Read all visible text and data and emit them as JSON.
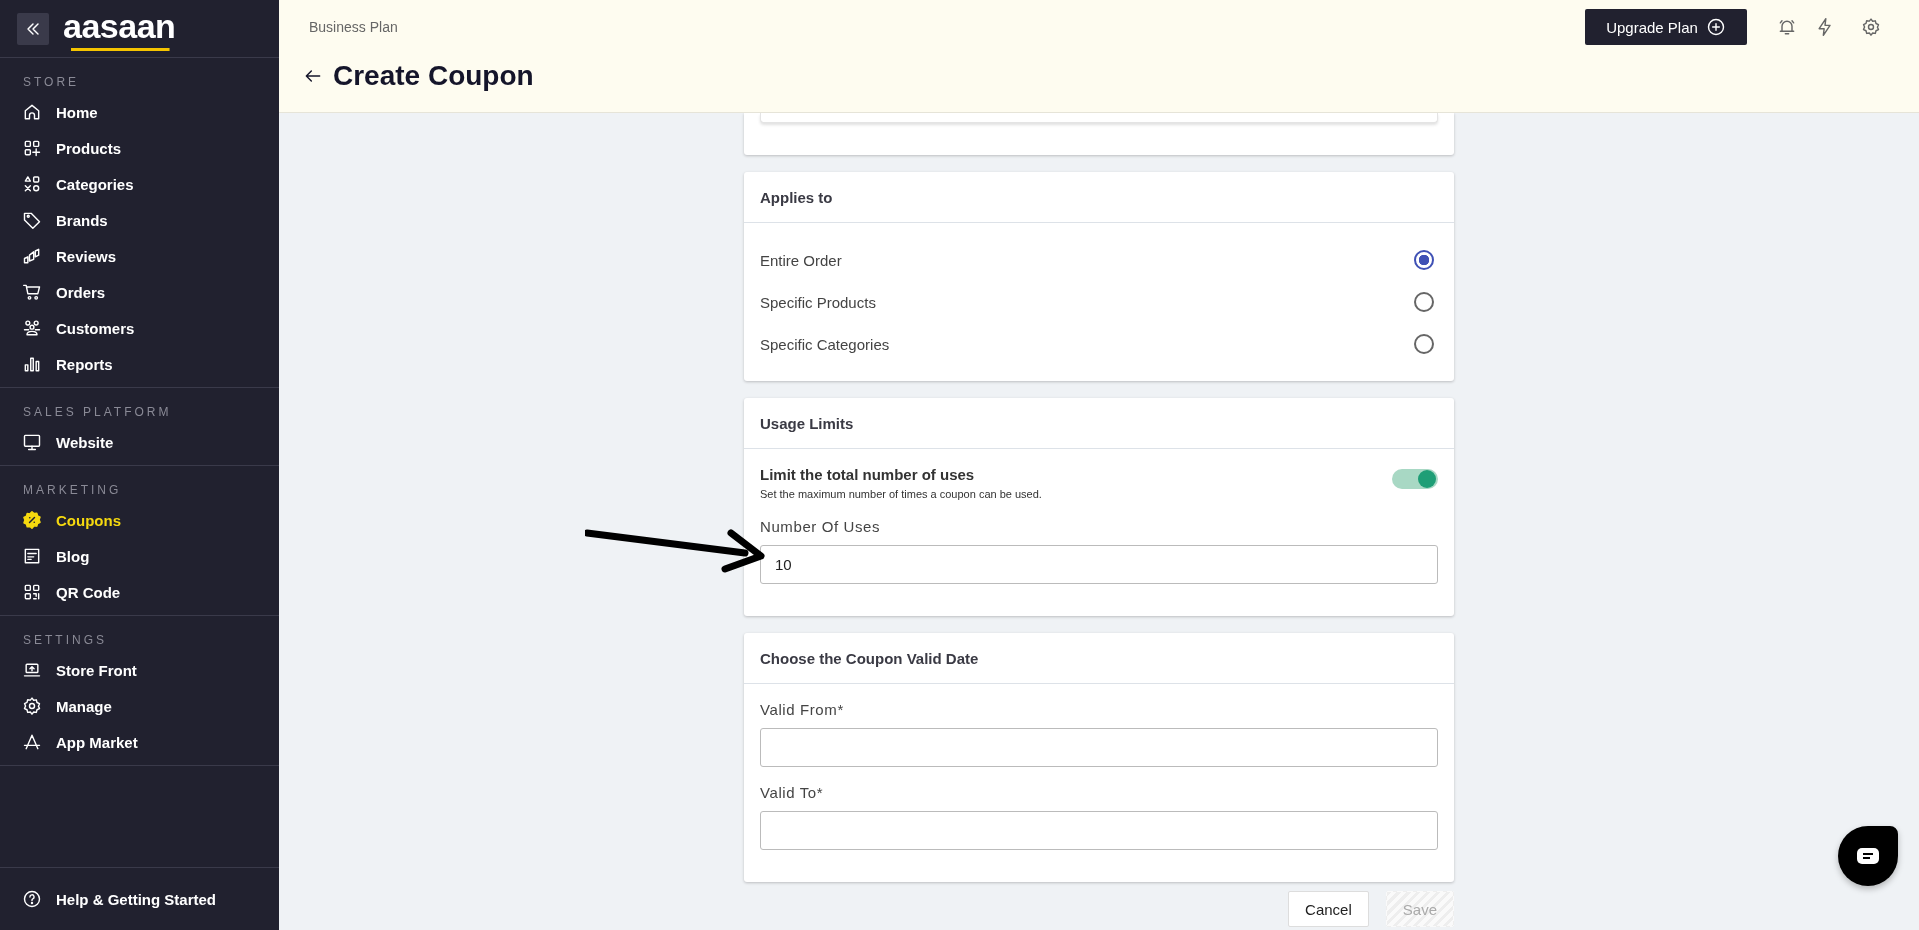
{
  "sidebar": {
    "logo": "aasaan",
    "sections": [
      {
        "title": "STORE",
        "items": [
          {
            "label": "Home",
            "selected": false
          },
          {
            "label": "Products",
            "selected": false
          },
          {
            "label": "Categories",
            "selected": false
          },
          {
            "label": "Brands",
            "selected": false
          },
          {
            "label": "Reviews",
            "selected": false
          },
          {
            "label": "Orders",
            "selected": false
          },
          {
            "label": "Customers",
            "selected": false
          },
          {
            "label": "Reports",
            "selected": false
          }
        ]
      },
      {
        "title": "SALES PLATFORM",
        "items": [
          {
            "label": "Website",
            "selected": false
          }
        ]
      },
      {
        "title": "MARKETING",
        "items": [
          {
            "label": "Coupons",
            "selected": true
          },
          {
            "label": "Blog",
            "selected": false
          },
          {
            "label": "QR Code",
            "selected": false
          }
        ]
      },
      {
        "title": "SETTINGS",
        "items": [
          {
            "label": "Store Front",
            "selected": false
          },
          {
            "label": "Manage",
            "selected": false
          },
          {
            "label": "App Market",
            "selected": false
          }
        ]
      }
    ],
    "help": "Help & Getting Started"
  },
  "header": {
    "plan": "Business Plan",
    "title": "Create Coupon",
    "upgrade_button": "Upgrade Plan"
  },
  "applies_to": {
    "title": "Applies to",
    "options": [
      {
        "label": "Entire Order",
        "selected": true
      },
      {
        "label": "Specific Products",
        "selected": false
      },
      {
        "label": "Specific Categories",
        "selected": false
      }
    ]
  },
  "usage_limits": {
    "title": "Usage Limits",
    "toggle": {
      "label": "Limit the total number of uses",
      "description": "Set the maximum number of times a coupon can be used.",
      "on": true
    },
    "field": {
      "label": "Number Of Uses",
      "value": "10"
    }
  },
  "valid_date": {
    "title": "Choose the Coupon Valid Date",
    "fields": [
      {
        "label": "Valid From*"
      },
      {
        "label": "Valid To*"
      }
    ]
  },
  "actions": [
    {
      "label": "Cancel",
      "disabled": false
    },
    {
      "label": "Save",
      "disabled": true
    }
  ]
}
